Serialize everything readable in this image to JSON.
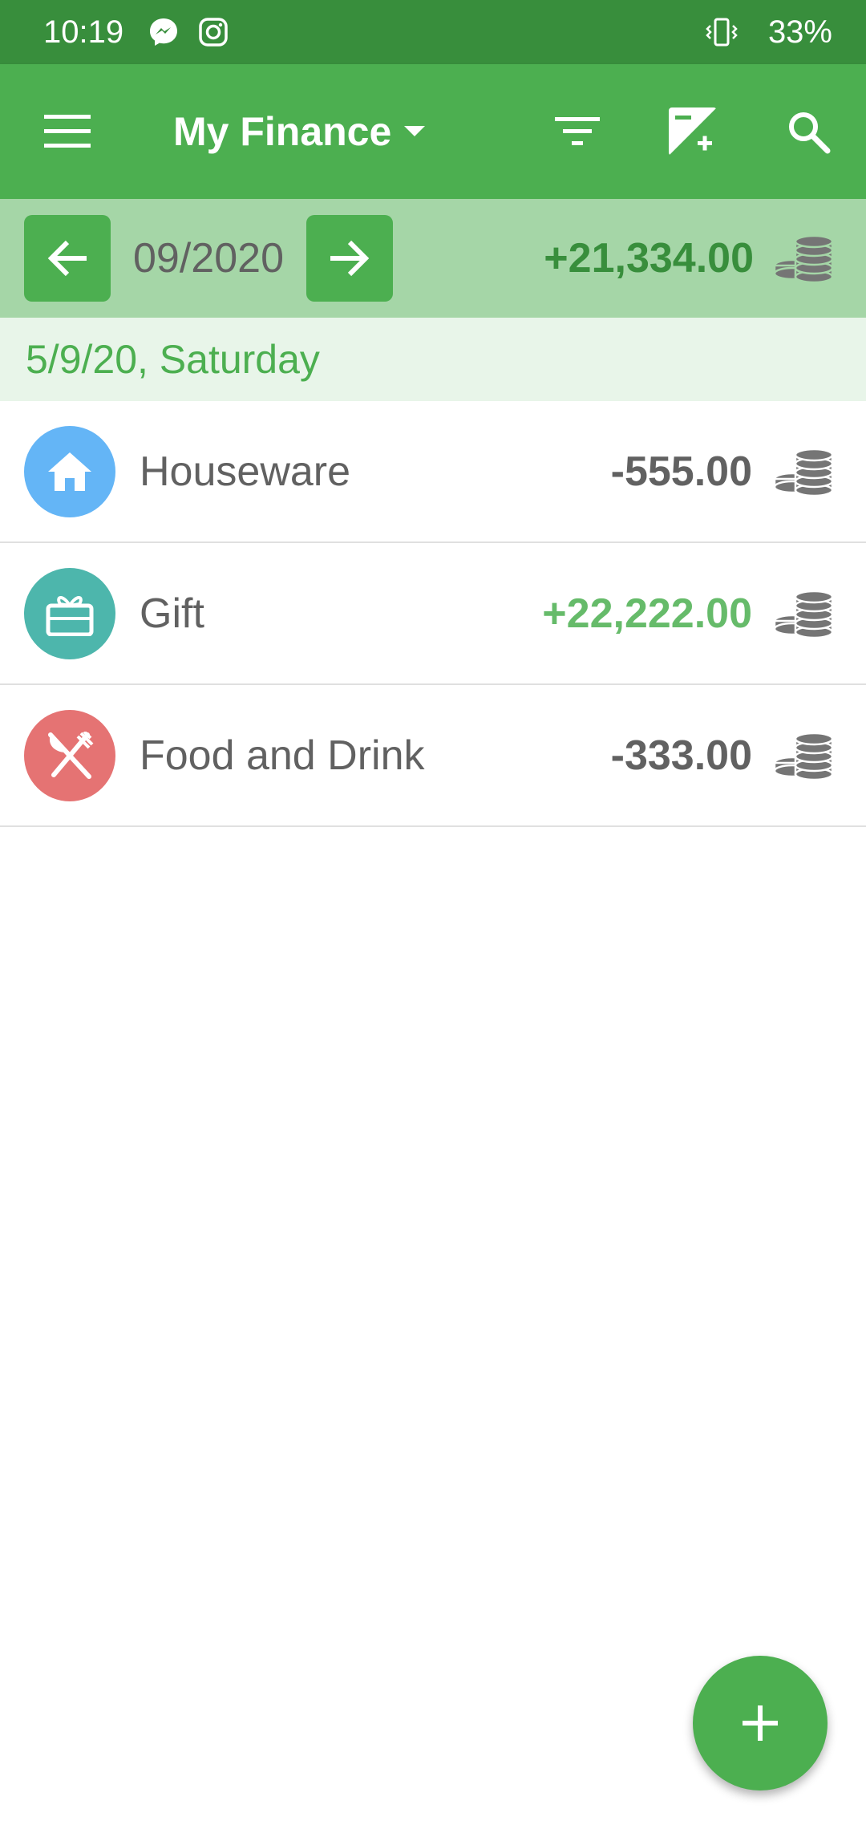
{
  "status_bar": {
    "time": "10:19",
    "battery": "33%"
  },
  "app_bar": {
    "title": "My Finance"
  },
  "month_nav": {
    "month": "09/2020",
    "total": "+21,334.00"
  },
  "date_header": "5/9/20, Saturday",
  "transactions": [
    {
      "label": "Houseware",
      "amount": "-555.00",
      "icon": "home-icon",
      "color": "#64b5f6",
      "amount_color": "#616161"
    },
    {
      "label": "Gift",
      "amount": "+22,222.00",
      "icon": "gift-icon",
      "color": "#4db6ac",
      "amount_color": "#66bb6a"
    },
    {
      "label": "Food and Drink",
      "amount": "-333.00",
      "icon": "fork-knife-icon",
      "color": "#e57373",
      "amount_color": "#616161"
    }
  ],
  "colors": {
    "primary": "#4caf50",
    "primary_dark": "#388e3c",
    "month_bg": "#a5d6a7",
    "date_bg": "#e8f5e9"
  }
}
